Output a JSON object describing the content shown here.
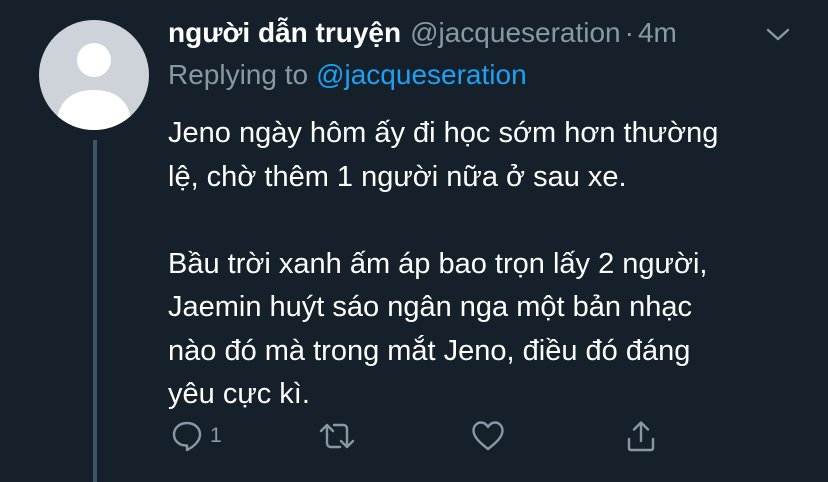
{
  "tweet": {
    "author_name": "người dẫn truyện",
    "author_handle": "@jacqueseration",
    "separator": "·",
    "timestamp": "4m",
    "replying_prefix": "Replying to",
    "replying_to": "@jacqueseration",
    "body_lines": [
      "Jeno ngày hôm ấy đi học sớm hơn thường",
      "lệ, chờ thêm 1 người nữa ở sau xe.",
      "Bầu trời xanh ấm áp bao trọn lấy 2 người,",
      "Jaemin huýt sáo ngân nga một bản nhạc",
      "nào đó mà trong mắt Jeno, điều đó đáng",
      "yêu cực kì."
    ]
  },
  "actions": {
    "reply_icon": "reply-icon",
    "reply_count": "1",
    "retweet_icon": "retweet-icon",
    "like_icon": "heart-icon",
    "share_icon": "share-icon",
    "menu_icon": "chevron-down-icon"
  },
  "colors": {
    "background": "#15202b",
    "text": "#ffffff",
    "muted": "#8899a6",
    "link": "#1da1f2",
    "thread_line": "#3d5466",
    "avatar_bg": "#cdd3d8",
    "avatar_fg": "#ffffff"
  }
}
